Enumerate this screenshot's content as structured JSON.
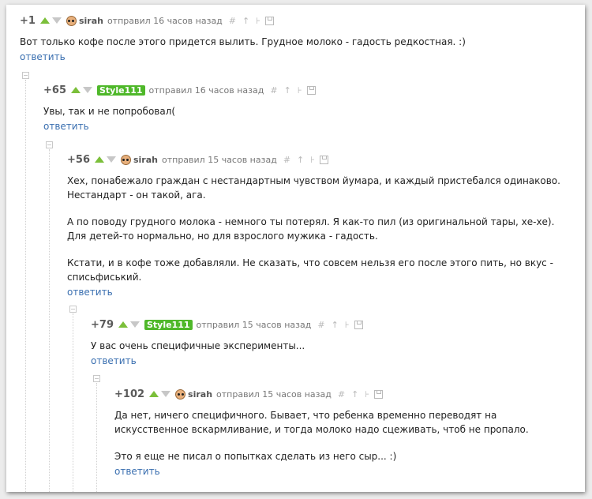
{
  "comments": [
    {
      "rating": "+1",
      "author": "sirah",
      "time": "отправил 16 часов назад",
      "paragraphs": [
        "Вот только кофе после этого придется вылить. Грудное молоко - гадость редкостная. :)"
      ],
      "reply": "ответить"
    },
    {
      "rating": "+65",
      "author": "Style111",
      "time": "отправил 16 часов назад",
      "paragraphs": [
        "Увы, так и не попробовал("
      ],
      "reply": "ответить"
    },
    {
      "rating": "+56",
      "author": "sirah",
      "time": "отправил 15 часов назад",
      "paragraphs": [
        "Хех, понабежало граждан с нестандартным чувством йумара, и каждый пристебался одинаково. Нестандарт - он такой, ага.",
        "А по поводу грудного молока - немного ты потерял. Я как-то пил (из оригинальной тары, хе-хе). Для детей-то нормально, но для взрослого мужика - гадость.",
        "Кстати, и в кофе тоже добавляли. Не сказать, что совсем нельзя его после этого пить, но вкус - списьфиський."
      ],
      "reply": "ответить"
    },
    {
      "rating": "+79",
      "author": "Style111",
      "time": "отправил 15 часов назад",
      "paragraphs": [
        "У вас очень специфичные эксперименты..."
      ],
      "reply": "ответить"
    },
    {
      "rating": "+102",
      "author": "sirah",
      "time": "отправил 15 часов назад",
      "paragraphs": [
        "Да нет, ничего специфичного. Бывает, что ребенка временно переводят на искусственное вскармливание, и тогда молоко надо сцеживать, чтоб не пропало.",
        "Это я еще не писал о попытках сделать из него сыр... :)"
      ],
      "reply": "ответить"
    }
  ],
  "tools": {
    "link": "#",
    "parent": "↑",
    "branch": "⊦"
  },
  "colors": {
    "upvote": "#7bbf3a",
    "downvote": "#c7c7c7",
    "reply_link": "#3a6fb0",
    "badge": "#4fb82a"
  }
}
